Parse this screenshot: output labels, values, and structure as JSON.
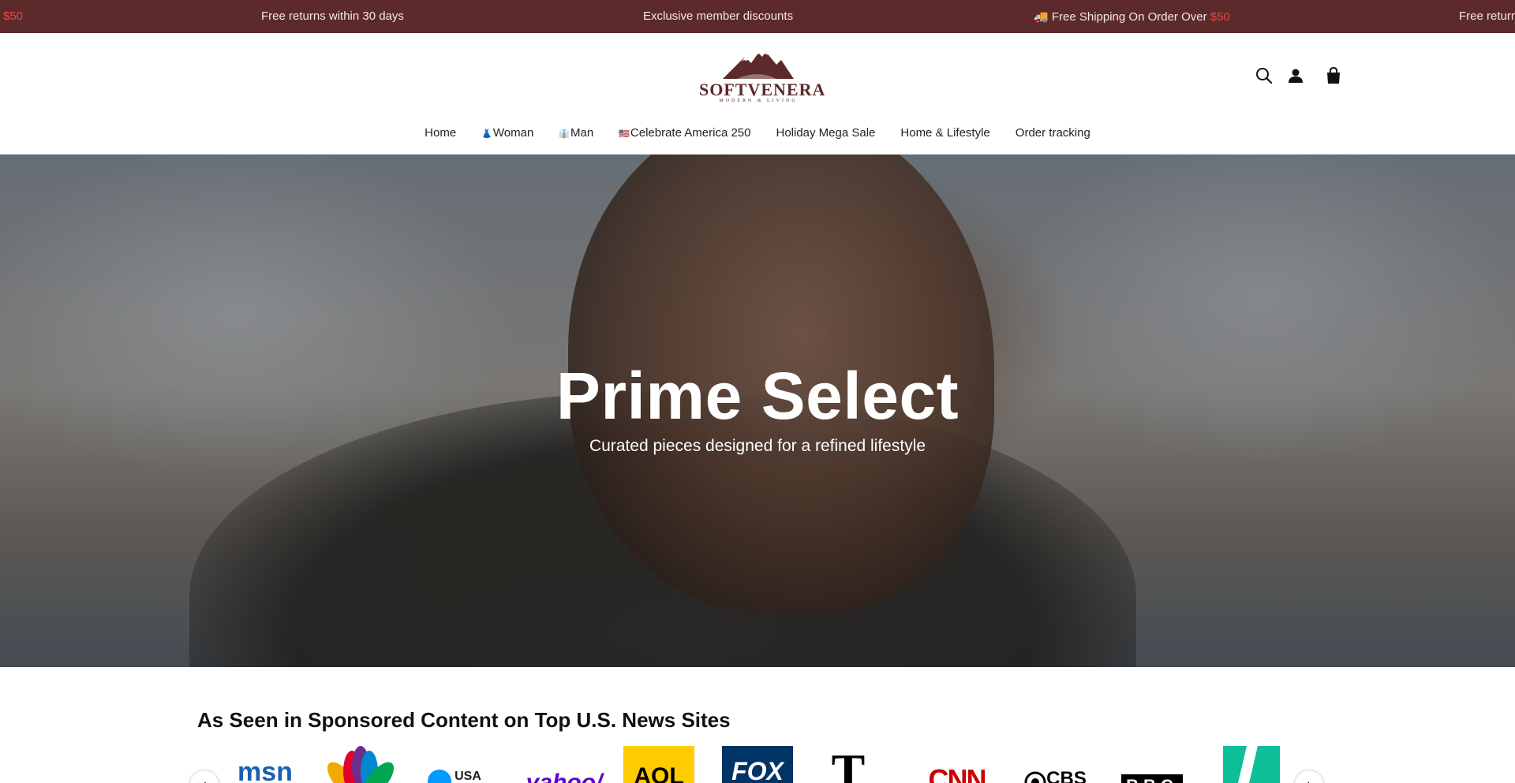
{
  "announcement": {
    "items": [
      {
        "text": "$50",
        "highlight": true
      },
      {
        "text": "Free returns within 30 days"
      },
      {
        "text": "Exclusive member discounts"
      },
      {
        "text_before": "🚚 Free Shipping On Order Over ",
        "highlight_text": "$50"
      },
      {
        "text": "Free return"
      }
    ],
    "colors": {
      "background": "#5c2a2a",
      "highlight": "#e24a3f"
    }
  },
  "header": {
    "logo": {
      "word": "SOFTVENERA",
      "tagline": "MODERN & LIVING"
    },
    "icons": [
      "search-icon",
      "account-icon",
      "cart-icon"
    ]
  },
  "nav": {
    "items": [
      {
        "label": "Home"
      },
      {
        "lead": "👗",
        "label": "Woman"
      },
      {
        "lead": "👔",
        "label": "Man"
      },
      {
        "lead": "🇺🇸",
        "label": "Celebrate America 250"
      },
      {
        "label": "Holiday Mega Sale"
      },
      {
        "label": "Home & Lifestyle"
      },
      {
        "label": "Order tracking"
      }
    ]
  },
  "hero": {
    "title": "Prime Select",
    "subtitle": "Curated pieces designed for a refined lifestyle"
  },
  "press": {
    "title": "As Seen in Sponsored Content on Top U.S. News Sites",
    "logos": [
      {
        "name": "msn",
        "text": "msn"
      },
      {
        "name": "nbc",
        "text": ""
      },
      {
        "name": "usa-today",
        "text": "USA"
      },
      {
        "name": "yahoo",
        "text": "yahoo/"
      },
      {
        "name": "aol",
        "text": "AOL"
      },
      {
        "name": "fox",
        "text": "FOX"
      },
      {
        "name": "nyt",
        "text": "T"
      },
      {
        "name": "cnn",
        "text": "CNN"
      },
      {
        "name": "cbs",
        "text": "CBS"
      },
      {
        "name": "bbc",
        "text": "BBC"
      },
      {
        "name": "huffpost",
        "text": ""
      }
    ],
    "prev": "‹",
    "next": "›"
  }
}
